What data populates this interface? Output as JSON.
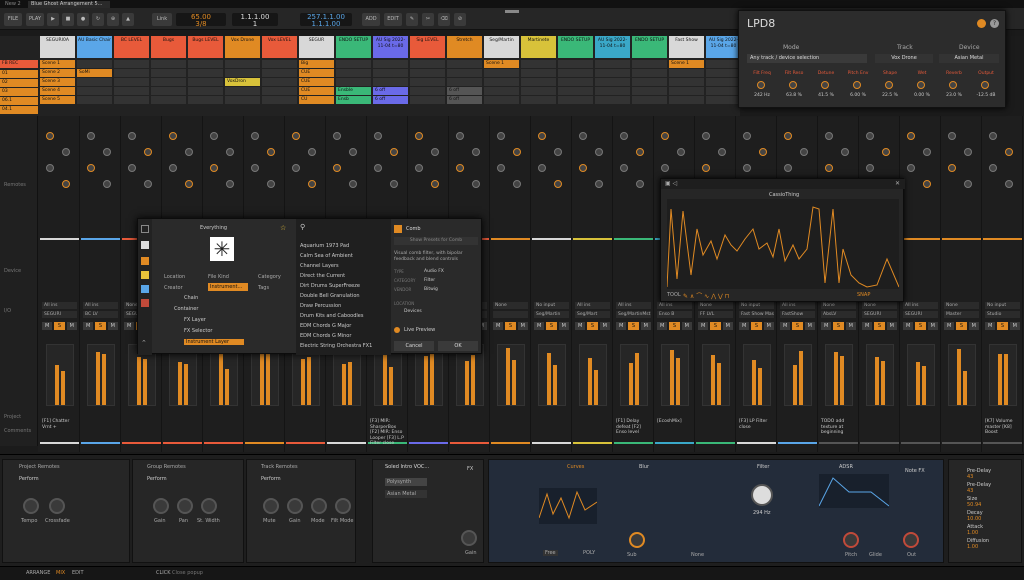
{
  "tabs": [
    "New 2",
    "Blue Ghost Arrangement 5..."
  ],
  "toolbar": {
    "file": "FILE",
    "play": "PLAY",
    "link": "Link",
    "tempo": "65.00",
    "sig": "3/8",
    "pos": "1.1.1.00",
    "pos2": "1",
    "time": "257.1.1.00",
    "time2": "1.1.1.00",
    "add": "ADD",
    "edit": "EDIT"
  },
  "tracks": [
    {
      "name": "SEGURI0A",
      "color": "#d8d8d8",
      "slots": [
        [
          "Scene 1",
          "#e08a23"
        ],
        [
          "Scene 2",
          "#e08a23"
        ],
        [
          "Scene 3",
          "#e08a23"
        ],
        [
          "Scene 4",
          "#e08a23"
        ],
        [
          "Scene 5",
          "#e08a23"
        ]
      ],
      "route": "All ins",
      "out": "SEGURI",
      "comment": "[F1] Chatter Vrnt +"
    },
    {
      "name": "AU Basic Chair",
      "color": "#5aa6e8",
      "slots": [
        [
          "",
          "#333"
        ],
        [
          "SoMi",
          "#e08a23"
        ],
        [
          "",
          "#333"
        ],
        [
          "",
          "#333"
        ],
        [
          "",
          "#333"
        ]
      ],
      "route": "All ins",
      "out": "BC LV",
      "comment": ""
    },
    {
      "name": "BC LEVEL",
      "color": "#e85a3a",
      "slots": [
        [
          "",
          "#333"
        ],
        [
          "",
          "#333"
        ],
        [
          "",
          "#333"
        ],
        [
          "",
          "#333"
        ],
        [
          "",
          "#333"
        ]
      ],
      "route": "None",
      "out": "SEGURI",
      "comment": ""
    },
    {
      "name": "Bugs",
      "color": "#e85a3a",
      "slots": [
        [
          "",
          "#333"
        ],
        [
          "",
          "#333"
        ],
        [
          "",
          "#333"
        ],
        [
          "",
          "#333"
        ],
        [
          "",
          "#333"
        ]
      ],
      "route": "All ins",
      "out": "SEGURI",
      "comment": ""
    },
    {
      "name": "Bugs LEVEL",
      "color": "#e85a3a",
      "slots": [
        [
          "",
          "#333"
        ],
        [
          "",
          "#333"
        ],
        [
          "",
          "#333"
        ],
        [
          "",
          "#333"
        ],
        [
          "",
          "#333"
        ]
      ],
      "route": "None",
      "out": "",
      "comment": ""
    },
    {
      "name": "Vox Drone",
      "color": "#e08a23",
      "slots": [
        [
          "",
          "#333"
        ],
        [
          "",
          "#333"
        ],
        [
          "VoxDron",
          "#d8c23a"
        ],
        [
          "",
          "#333"
        ],
        [
          "",
          "#333"
        ]
      ],
      "route": "All ins",
      "out": "",
      "comment": ""
    },
    {
      "name": "Vox LEVEL",
      "color": "#e85a3a",
      "slots": [
        [
          "",
          "#333"
        ],
        [
          "",
          "#333"
        ],
        [
          "",
          "#333"
        ],
        [
          "",
          "#333"
        ],
        [
          "",
          "#333"
        ]
      ],
      "route": "None",
      "out": "",
      "comment": ""
    },
    {
      "name": "SEGUR",
      "color": "#d8d8d8",
      "slots": [
        [
          "Big",
          "#e08a23"
        ],
        [
          "CUE",
          "#e08a23"
        ],
        [
          "CUE",
          "#e08a23"
        ],
        [
          "CUE",
          "#e08a23"
        ],
        [
          "CU",
          "#e08a23"
        ]
      ],
      "route": "None",
      "out": "",
      "comment": ""
    },
    {
      "name": "ENDO SETUP",
      "color": "#3ab878",
      "slots": [
        [
          "",
          "#333"
        ],
        [
          "",
          "#333"
        ],
        [
          "",
          "#333"
        ],
        [
          "Ensble",
          "#3ab878"
        ],
        [
          "Ensb",
          "#3ab878"
        ]
      ],
      "route": "None",
      "out": "",
      "comment": "[F3] MIR: SharperBox [F2] MIR: Enso Looper [F3] L.P Filter close"
    },
    {
      "name": "AU Sig 2022-11-04 t=80",
      "color": "#6a6ae8",
      "slots": [
        [
          "",
          "#333"
        ],
        [
          "",
          "#333"
        ],
        [
          "",
          "#333"
        ],
        [
          "6 off",
          "#6a6ae8"
        ],
        [
          "6 off",
          "#6a6ae8"
        ]
      ],
      "route": "All ins",
      "out": "",
      "comment": ""
    },
    {
      "name": "Sig LEVEL",
      "color": "#e85a3a",
      "slots": [
        [
          "",
          "#333"
        ],
        [
          "",
          "#333"
        ],
        [
          "",
          "#333"
        ],
        [
          "",
          "#333"
        ],
        [
          "",
          "#333"
        ]
      ],
      "route": "None",
      "out": "",
      "comment": ""
    },
    {
      "name": "Stretch",
      "color": "#e08a23",
      "slots": [
        [
          "",
          "#333"
        ],
        [
          "",
          "#333"
        ],
        [
          "",
          "#333"
        ],
        [
          "6 off",
          "#555"
        ],
        [
          "6 off",
          "#555"
        ]
      ],
      "route": "None",
      "out": "",
      "comment": ""
    },
    {
      "name": "Seg/Martin",
      "color": "#d8d8d8",
      "slots": [
        [
          "Scene 1",
          "#e08a23"
        ],
        [
          "",
          "#333"
        ],
        [
          "",
          "#333"
        ],
        [
          "",
          "#333"
        ],
        [
          "",
          "#333"
        ]
      ],
      "route": "No input",
      "out": "Seg/Martin",
      "comment": ""
    },
    {
      "name": "Martinete",
      "color": "#d8c23a",
      "slots": [
        [
          "",
          "#333"
        ],
        [
          "",
          "#333"
        ],
        [
          "",
          "#333"
        ],
        [
          "",
          "#333"
        ],
        [
          "",
          "#333"
        ]
      ],
      "route": "All ins",
      "out": "Seg/Mart",
      "comment": ""
    },
    {
      "name": "ENDO SETUP",
      "color": "#3ab878",
      "slots": [
        [
          "",
          "#333"
        ],
        [
          "",
          "#333"
        ],
        [
          "",
          "#333"
        ],
        [
          "",
          "#333"
        ],
        [
          "",
          "#333"
        ]
      ],
      "route": "All ins",
      "out": "Seg/MartinMst",
      "comment": "[F1] Delay defeat [F2] Enso level"
    },
    {
      "name": "AU Sig 2022-11-04 t=80",
      "color": "#3aa8c8",
      "slots": [
        [
          "",
          "#333"
        ],
        [
          "",
          "#333"
        ],
        [
          "",
          "#333"
        ],
        [
          "",
          "#333"
        ],
        [
          "",
          "#333"
        ]
      ],
      "route": "All ins",
      "out": "Enso B",
      "comment": "[EcoshMix]"
    },
    {
      "name": "ENDO SETUP",
      "color": "#3ab878",
      "slots": [
        [
          "",
          "#333"
        ],
        [
          "",
          "#333"
        ],
        [
          "",
          "#333"
        ],
        [
          "",
          "#333"
        ],
        [
          "",
          "#333"
        ]
      ],
      "route": "None",
      "out": "FF LVL",
      "comment": ""
    },
    {
      "name": "Fast Show",
      "color": "#d8d8d8",
      "slots": [
        [
          "Scene 1",
          "#e08a23"
        ],
        [
          "",
          "#333"
        ],
        [
          "",
          "#333"
        ],
        [
          "",
          "#333"
        ],
        [
          "",
          "#333"
        ]
      ],
      "route": "No input",
      "out": "Fast Show Master",
      "comment": "[F3] LP Filter close"
    },
    {
      "name": "AU Sig 2022-11-04 t=80",
      "color": "#5aa6e8",
      "slots": [
        [
          "",
          "#333"
        ],
        [
          "",
          "#333"
        ],
        [
          "",
          "#333"
        ],
        [
          "",
          "#333"
        ],
        [
          "",
          "#333"
        ]
      ],
      "route": "All ins",
      "out": "FastShow",
      "comment": ""
    }
  ],
  "extra_strips": [
    {
      "route": "None",
      "out": "AbsLV",
      "comment": "TODO add texture at beginning"
    },
    {
      "route": "None",
      "out": "SEGURI",
      "comment": ""
    },
    {
      "route": "All ins",
      "out": "SEGURI",
      "comment": ""
    },
    {
      "route": "None",
      "out": "Master",
      "comment": ""
    },
    {
      "route": "No input",
      "out": "Studio",
      "comment": "[K7] Volume master [K8] Boost"
    }
  ],
  "left_labels": {
    "fbrec": "FB REC",
    "remotes": "Remotes",
    "device": "Device",
    "io": "I/O",
    "project": "Project",
    "comments": "Comments"
  },
  "lpd": {
    "title": "LPD8",
    "mode_label": "Mode",
    "mode": "Any track / device selection",
    "track_label": "Track",
    "track": "Vox Drone",
    "device_label": "Device",
    "device": "Asian Metal",
    "knobs": [
      [
        "Filt Freq",
        "242 Hz"
      ],
      [
        "Filt Reso",
        "63.8 %"
      ],
      [
        "Detune",
        "41.5 %"
      ],
      [
        "Pitch Env",
        "6.00 %"
      ],
      [
        "Shape",
        "22.5 %"
      ],
      [
        "Wet",
        "0.00 %"
      ],
      [
        "Reverb",
        "23.0 %"
      ],
      [
        "Output",
        "-12.5 dB"
      ]
    ]
  },
  "browser": {
    "title": "Everything",
    "filters": [
      "Location",
      "File Kind",
      "Creator",
      "Instrument...",
      "Category",
      "Tags"
    ],
    "tree": [
      "Chain",
      "Container",
      "FX Layer",
      "FX Selector",
      "Instrument Layer"
    ],
    "presets": [
      "Aquarium 1973 Pad",
      "Calm Sea of Ambient",
      "Channel Layers",
      "Direct the Current",
      "Dirt Drums SuperFreeze",
      "Double Bell Granulation",
      "Draw Percussion",
      "Drum Kits and Caboodles",
      "EDM Chords G Major",
      "EDM Chords G Minor",
      "Electric String Orchestra FX1"
    ],
    "info_title": "Comb",
    "show_presets": "Show Presets for Comb",
    "desc": "Visual comb filter, with bipolar feedback and blend controls",
    "type_label": "TYPE",
    "type": "Audio FX",
    "cat_label": "CATEGORY",
    "cat": "Filter",
    "vendor_label": "VENDOR",
    "vendor": "Bitwig",
    "loc_label": "LOCATION",
    "loc": "Devices",
    "live": "Live Preview",
    "cancel": "Cancel",
    "ok": "OK"
  },
  "cassio": {
    "title": "CassioThing",
    "tool": "TOOL",
    "snap": "SNAP"
  },
  "bottom": {
    "project_remotes": "Project Remotes",
    "perform": "Perform",
    "tempo": "Tempo",
    "crossfade": "Crossfade",
    "group_remotes": "Group Remotes",
    "gain": "Gain",
    "pan": "Pan",
    "stwidth": "St. Width",
    "track_remotes": "Track Remotes",
    "mute": "Mute",
    "mode": "Mode",
    "filt": "Filt Mode",
    "layer_title": "Soled Intro VOC...",
    "layers": [
      "Polysynth",
      "Asian Metal"
    ],
    "fx": "FX",
    "curves": "Curves",
    "blur": "Blur",
    "filter": "Filter",
    "adsr": "ADSR",
    "notefx": "Note FX",
    "freq": "294 Hz",
    "none": "None",
    "sub": "Sub",
    "freeze": "Free",
    "poly": "POLY",
    "pitch": "Pitch",
    "glide": "Glide",
    "out": "Out",
    "list": [
      [
        "Pre-Delay",
        "43"
      ],
      [
        "Pre-Delay",
        "43"
      ],
      [
        "Size",
        "50.94"
      ],
      [
        "Decay",
        "10.00"
      ],
      [
        "Attack",
        "1.00"
      ],
      [
        "Diffusion",
        "1.00"
      ]
    ]
  },
  "status": {
    "arrange": "ARRANGE",
    "mix": "MIX",
    "edit": "EDIT",
    "click": "CLICK",
    "popup": "Close popup"
  }
}
